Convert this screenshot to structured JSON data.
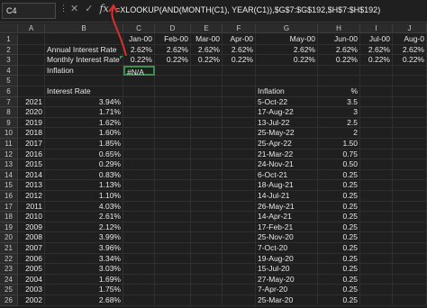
{
  "namebox": "C4",
  "formula": "=XLOOKUP(AND(MONTH(C1), YEAR(C1)),$G$7:$G$192,$H$7:$H$192)",
  "columns": [
    "A",
    "B",
    "C",
    "D",
    "E",
    "F",
    "G",
    "H",
    "I",
    "J"
  ],
  "row_numbers": [
    "1",
    "2",
    "3",
    "4",
    "5",
    "6",
    "7",
    "8",
    "9",
    "10",
    "11",
    "12",
    "13",
    "14",
    "15",
    "16",
    "17",
    "18",
    "19",
    "20",
    "21",
    "22",
    "23",
    "24",
    "25",
    "26"
  ],
  "row1": {
    "C": "Jan-00",
    "D": "Feb-00",
    "E": "Mar-00",
    "F": "Apr-00",
    "G": "May-00",
    "H": "Jun-00",
    "I": "Jul-00",
    "J": "Aug-0"
  },
  "row2": {
    "B": "Annual Interest Rate",
    "C": "2.62%",
    "D": "2.62%",
    "E": "2.62%",
    "F": "2.62%",
    "G": "2.62%",
    "H": "2.62%",
    "I": "2.62%",
    "J": "2.62%"
  },
  "row3": {
    "B": "Monthly Interest Rate",
    "C": "0.22%",
    "D": "0.22%",
    "E": "0.22%",
    "F": "0.22%",
    "G": "0.22%",
    "H": "0.22%",
    "I": "0.22%",
    "J": "0.22%"
  },
  "row4": {
    "B": "Inflation",
    "C": "#N/A"
  },
  "row6": {
    "B": "Interest Rate",
    "G": "Inflation",
    "H": "%"
  },
  "rates": [
    {
      "year": "2021",
      "rate": "3.94%",
      "date": "5-Oct-22",
      "pct": "3.5"
    },
    {
      "year": "2020",
      "rate": "1.71%",
      "date": "17-Aug-22",
      "pct": "3"
    },
    {
      "year": "2019",
      "rate": "1.62%",
      "date": "13-Jul-22",
      "pct": "2.5"
    },
    {
      "year": "2018",
      "rate": "1.60%",
      "date": "25-May-22",
      "pct": "2"
    },
    {
      "year": "2017",
      "rate": "1.85%",
      "date": "25-Apr-22",
      "pct": "1.50"
    },
    {
      "year": "2016",
      "rate": "0.65%",
      "date": "21-Mar-22",
      "pct": "0.75"
    },
    {
      "year": "2015",
      "rate": "0.29%",
      "date": "24-Nov-21",
      "pct": "0.50"
    },
    {
      "year": "2014",
      "rate": "0.83%",
      "date": "6-Oct-21",
      "pct": "0.25"
    },
    {
      "year": "2013",
      "rate": "1.13%",
      "date": "18-Aug-21",
      "pct": "0.25"
    },
    {
      "year": "2012",
      "rate": "1.10%",
      "date": "14-Jul-21",
      "pct": "0.25"
    },
    {
      "year": "2011",
      "rate": "4.03%",
      "date": "26-May-21",
      "pct": "0.25"
    },
    {
      "year": "2010",
      "rate": "2.61%",
      "date": "14-Apr-21",
      "pct": "0.25"
    },
    {
      "year": "2009",
      "rate": "2.12%",
      "date": "17-Feb-21",
      "pct": "0.25"
    },
    {
      "year": "2008",
      "rate": "3.99%",
      "date": "25-Nov-20",
      "pct": "0.25"
    },
    {
      "year": "2007",
      "rate": "3.96%",
      "date": "7-Oct-20",
      "pct": "0.25"
    },
    {
      "year": "2006",
      "rate": "3.34%",
      "date": "19-Aug-20",
      "pct": "0.25"
    },
    {
      "year": "2005",
      "rate": "3.03%",
      "date": "15-Jul-20",
      "pct": "0.25"
    },
    {
      "year": "2004",
      "rate": "1.69%",
      "date": "27-May-20",
      "pct": "0.25"
    },
    {
      "year": "2003",
      "rate": "1.75%",
      "date": "7-Apr-20",
      "pct": "0.25"
    },
    {
      "year": "2002",
      "rate": "2.68%",
      "date": "25-Mar-20",
      "pct": "0.25"
    }
  ]
}
